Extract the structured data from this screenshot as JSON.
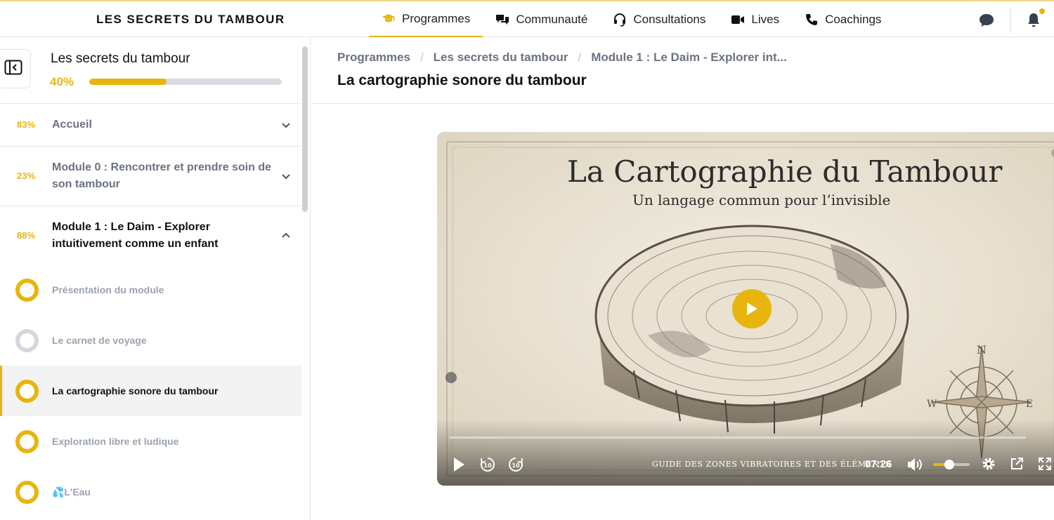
{
  "brand": "LES SECRETS DU TAMBOUR",
  "nav": [
    {
      "label": "Programmes",
      "icon": "graduation-cap-icon",
      "active": true
    },
    {
      "label": "Communauté",
      "icon": "chat-bubbles-icon",
      "active": false
    },
    {
      "label": "Consultations",
      "icon": "headset-icon",
      "active": false
    },
    {
      "label": "Lives",
      "icon": "video-camera-icon",
      "active": false
    },
    {
      "label": "Coachings",
      "icon": "phone-icon",
      "active": false
    }
  ],
  "accent_color": "#e8b50f",
  "sidebar": {
    "course_title": "Les secrets du tambour",
    "course_progress_label": "40%",
    "course_progress": 0.4,
    "modules": [
      {
        "pct": "83%",
        "title": "Accueil",
        "expanded": false
      },
      {
        "pct": "23%",
        "title": "Module 0 : Rencontrer et prendre soin de son tambour",
        "expanded": false
      },
      {
        "pct": "88%",
        "title": "Module 1 : Le Daim - Explorer intuitivement comme un enfant",
        "expanded": true
      }
    ],
    "lessons": [
      {
        "title": "Présentation du module",
        "status": "done",
        "current": false
      },
      {
        "title": "Le carnet de voyage",
        "status": "not-started",
        "current": false
      },
      {
        "title": "La cartographie sonore du tambour",
        "status": "done",
        "current": true
      },
      {
        "title": "Exploration libre et ludique",
        "status": "done",
        "current": false
      },
      {
        "title": "💦L'Eau",
        "status": "done",
        "current": false
      }
    ]
  },
  "breadcrumb": [
    "Programmes",
    "Les secrets du tambour",
    "Module 1 : Le Daim - Explorer int..."
  ],
  "page_title": "La cartographie sonore du tambour",
  "video": {
    "title": "La Cartographie du Tambour",
    "subtitle": "Un langage commun pour l’invisible",
    "caption": "GUIDE DES ZONES VIBRATOIRES ET DES ÉLÉMENTS",
    "time": "07:26",
    "volume": 0.45
  }
}
